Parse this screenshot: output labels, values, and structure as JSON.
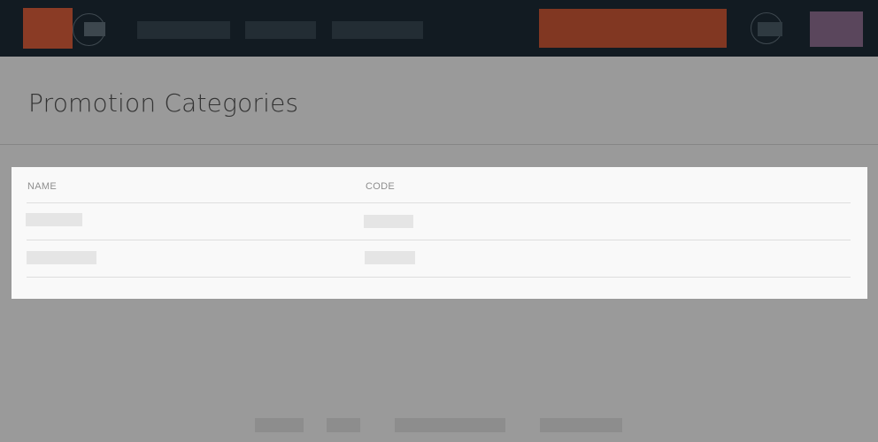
{
  "header": {
    "logo": "logo",
    "menu_icon": "menu-icon",
    "nav_items": [
      {
        "label": ""
      },
      {
        "label": ""
      },
      {
        "label": ""
      }
    ],
    "primary_action": {
      "label": ""
    },
    "account_icon": "account-icon",
    "avatar": "avatar"
  },
  "page": {
    "title": "Promotion Categories"
  },
  "table": {
    "columns": [
      "NAME",
      "CODE"
    ],
    "rows": [
      {
        "name": "",
        "code": ""
      },
      {
        "name": "",
        "code": ""
      }
    ]
  },
  "footer": {
    "links": [
      {
        "label": ""
      },
      {
        "label": ""
      },
      {
        "label": ""
      },
      {
        "label": ""
      }
    ]
  },
  "colors": {
    "topbar": "#121b22",
    "accent": "#813722",
    "page_background": "#9a9a9a",
    "card_background": "#f9f9f9"
  }
}
